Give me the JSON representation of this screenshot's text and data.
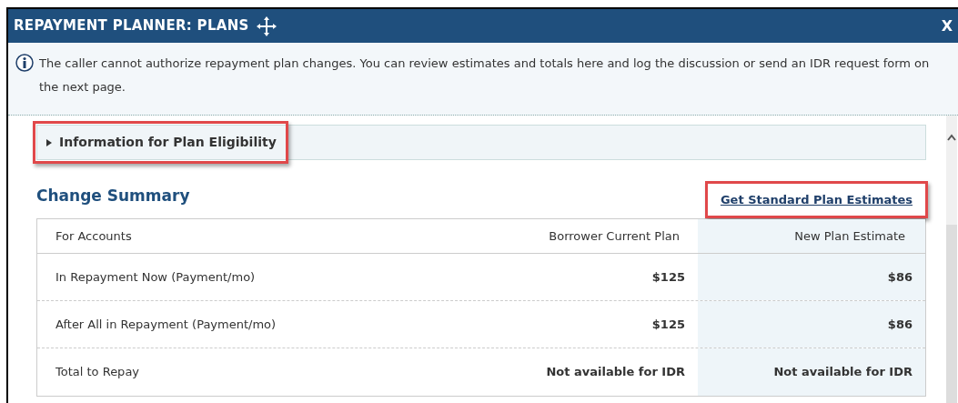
{
  "window": {
    "title": "REPAYMENT PLANNER: PLANS",
    "close": "X"
  },
  "notice": "The caller cannot authorize repayment plan changes. You can review estimates and totals here and log the discussion or send an IDR request form on the next page.",
  "eligibility": {
    "label": "Information for Plan Eligibility",
    "expanded": false,
    "highlighted": true
  },
  "summary": {
    "title": "Change Summary",
    "link": {
      "label": "Get Standard Plan Estimates",
      "highlighted": true
    }
  },
  "table": {
    "columns": [
      "For Accounts",
      "Borrower Current Plan",
      "New Plan Estimate"
    ],
    "rows": [
      {
        "label": "In Repayment Now (Payment/mo)",
        "current": "$125",
        "estimate": "$86"
      },
      {
        "label": "After All in Repayment (Payment/mo)",
        "current": "$125",
        "estimate": "$86"
      },
      {
        "label": "Total to Repay",
        "current": "Not available for IDR",
        "estimate": "Not available for IDR"
      }
    ]
  }
}
